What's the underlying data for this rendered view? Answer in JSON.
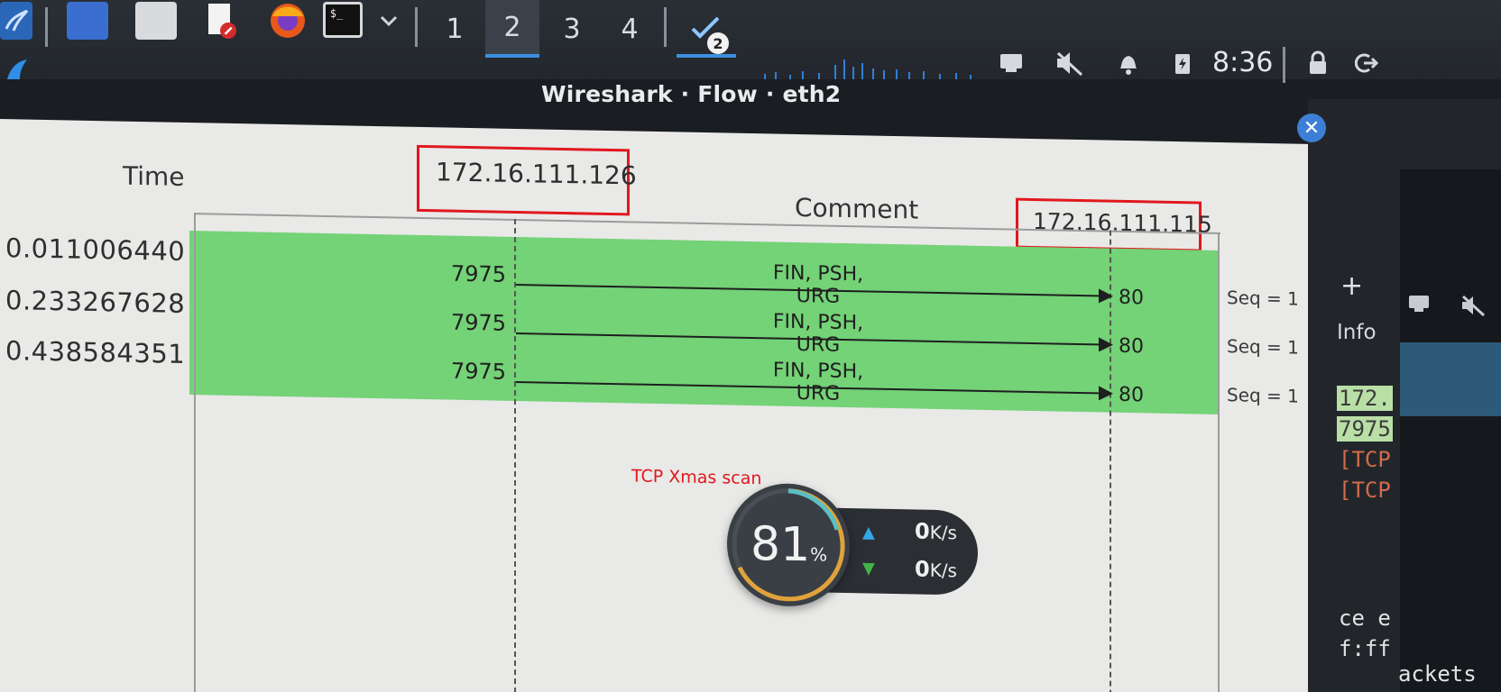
{
  "taskbar": {
    "workspaces": [
      "1",
      "2",
      "3",
      "4"
    ],
    "active_workspace": "2",
    "wireshark_badge": "2",
    "clock": "8:36",
    "terminal_glyph": "$_"
  },
  "window": {
    "title": "Wireshark · Flow · eth2"
  },
  "flow": {
    "time_header": "Time",
    "comment_header": "Comment",
    "host_left": "172.16.111.126",
    "host_right": "172.16.111.115",
    "rows": [
      {
        "time": "0.011006440",
        "src_port": "7975",
        "dst_port": "80",
        "flags": "FIN, PSH, URG",
        "comment": "Seq = 1"
      },
      {
        "time": "0.233267628",
        "src_port": "7975",
        "dst_port": "80",
        "flags": "FIN, PSH, URG",
        "comment": "Seq = 1"
      },
      {
        "time": "0.438584351",
        "src_port": "7975",
        "dst_port": "80",
        "flags": "FIN, PSH, URG",
        "comment": "Seq = 1"
      }
    ],
    "annotation": "TCP Xmas scan"
  },
  "widget": {
    "percent": "81",
    "percent_unit": "%",
    "upload": "0",
    "download": "0",
    "speed_unit": "K/s"
  },
  "side": {
    "plus": "+",
    "info_label": "Info",
    "term_lines": [
      "172.",
      "7975",
      "[TCP",
      "[TCP"
    ],
    "bottom_lines": [
      "ce e",
      "f:ff",
      "ackets"
    ]
  },
  "colors": {
    "row_highlight": "#74d277",
    "annotation_red": "#e0181e",
    "accent_blue": "#3b8fe0"
  }
}
